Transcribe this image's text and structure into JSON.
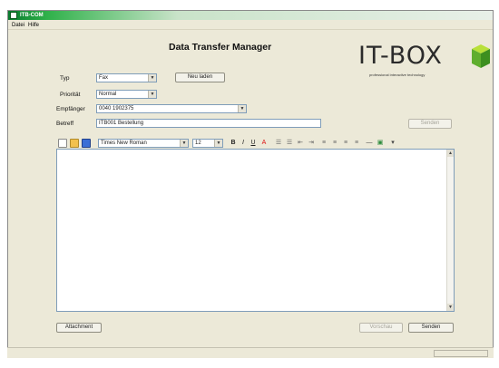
{
  "window": {
    "title": "ITB-COM"
  },
  "menu": [
    {
      "label": "Datei"
    },
    {
      "label": "Hilfe"
    }
  ],
  "app_title": "Data Transfer Manager",
  "logo": {
    "text": "IT-BOX",
    "tagline": "professional interactive technology"
  },
  "form": {
    "typ_label": "Typ",
    "typ_value": "Fax",
    "neu_button": "Neu laden",
    "prioritaet_label": "Priorität",
    "prioritaet_value": "Normal",
    "empfaenger_label": "Empfänger",
    "empfaenger_value": "0040 1902375",
    "betreff_label": "Betreff",
    "betreff_value": "ITB001 Bestellung",
    "side_button": "Senden"
  },
  "toolbar": {
    "font_value": "Times New Roman",
    "size_value": "12"
  },
  "bottom": {
    "attachment_button": "Attachment",
    "preview_button": "Vorschau",
    "send_button": "Senden"
  }
}
